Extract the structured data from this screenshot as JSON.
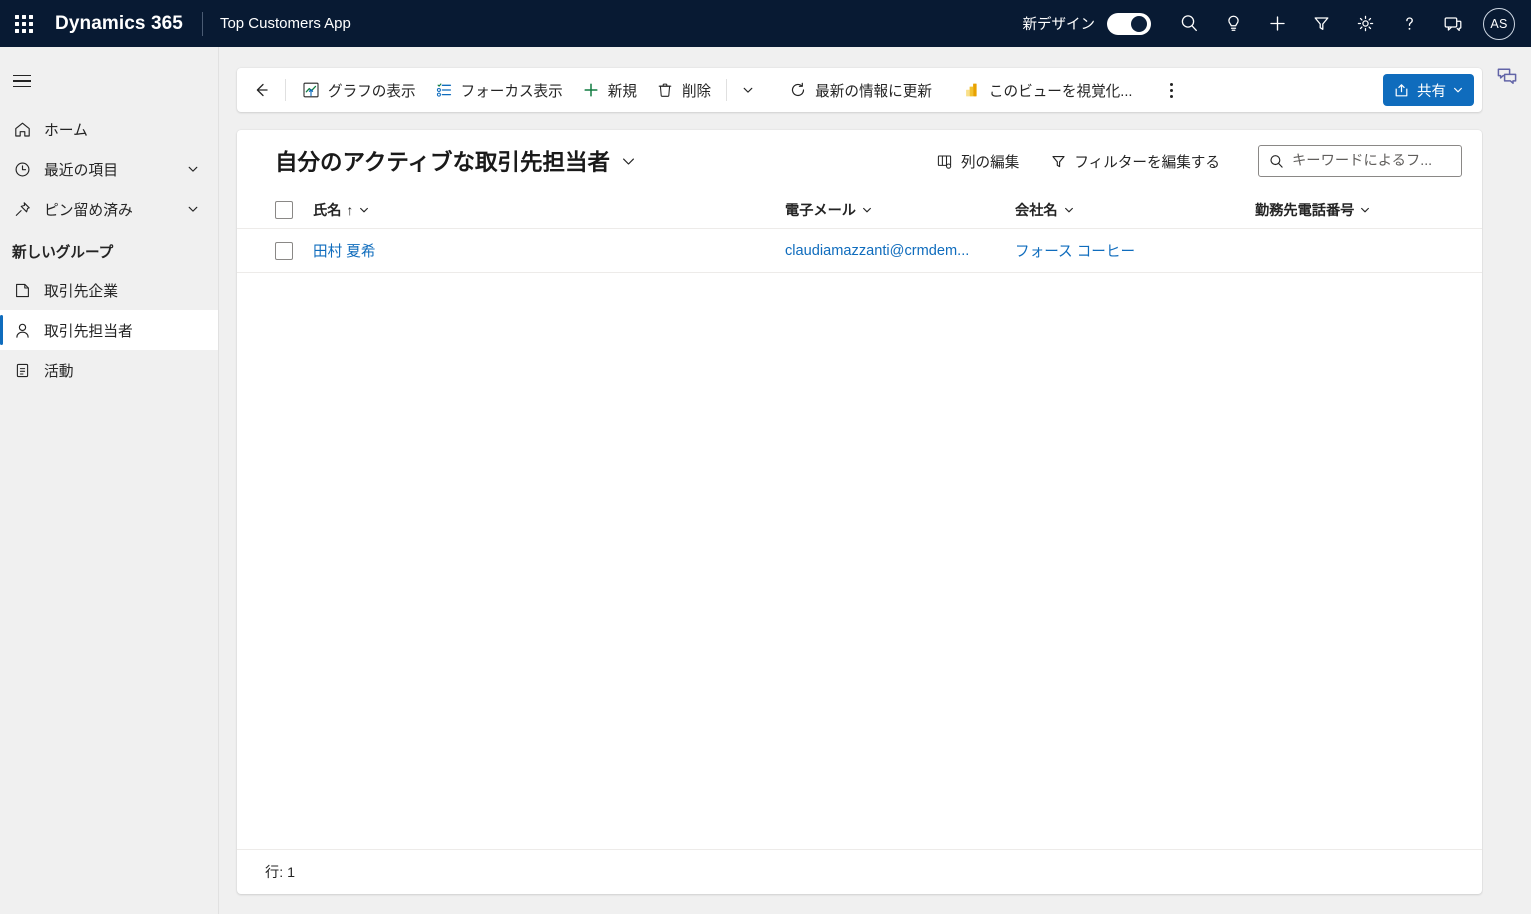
{
  "header": {
    "waffle_icon": "app-launcher-icon",
    "brand": "Dynamics 365",
    "app_name": "Top Customers App",
    "new_design_label": "新デザイン",
    "new_design_toggle_state": "on",
    "icons": [
      {
        "name": "search-icon",
        "label": "検索"
      },
      {
        "name": "lightbulb-icon",
        "label": "アシスト"
      },
      {
        "name": "plus-icon",
        "label": "新規作成"
      },
      {
        "name": "filter-icon",
        "label": "フィルター"
      },
      {
        "name": "gear-icon",
        "label": "設定"
      },
      {
        "name": "help-icon",
        "label": "ヘルプ"
      },
      {
        "name": "feedback-icon",
        "label": "フィードバック"
      }
    ],
    "avatar_initials": "AS"
  },
  "sidebar": {
    "hamburger_icon": "hamburger-icon",
    "items": [
      {
        "label": "ホーム",
        "icon": "home-icon",
        "chevron": false,
        "selected": false
      },
      {
        "label": "最近の項目",
        "icon": "clock-icon",
        "chevron": true,
        "selected": false
      },
      {
        "label": "ピン留め済み",
        "icon": "pin-icon",
        "chevron": true,
        "selected": false
      }
    ],
    "group_title": "新しいグループ",
    "group_items": [
      {
        "label": "取引先企業",
        "icon": "account-icon",
        "selected": false
      },
      {
        "label": "取引先担当者",
        "icon": "contact-person-icon",
        "selected": true
      },
      {
        "label": "活動",
        "icon": "activity-clipboard-icon",
        "selected": false
      }
    ]
  },
  "command_bar": {
    "back_icon": "back-arrow-icon",
    "buttons": [
      {
        "label": "グラフの表示",
        "icon": "show-chart-icon"
      },
      {
        "label": "フォーカス表示",
        "icon": "focused-view-icon"
      },
      {
        "label": "新規",
        "icon": "plus-icon"
      },
      {
        "label": "削除",
        "icon": "trash-icon"
      }
    ],
    "delete_chevron_icon": "chevron-down-icon",
    "refresh": {
      "label": "最新の情報に更新",
      "icon": "refresh-icon"
    },
    "visualize": {
      "label": "このビューを視覚化...",
      "icon": "power-bi-icon"
    },
    "overflow_icon": "more-options-icon",
    "share": {
      "label": "共有",
      "icon": "share-icon",
      "chevron_icon": "chevron-down-icon",
      "color": "#0f6cbd"
    }
  },
  "view": {
    "title": "自分のアクティブな取引先担当者",
    "title_chevron_icon": "chevron-down-icon",
    "edit_columns": {
      "label": "列の編集",
      "icon": "edit-columns-icon"
    },
    "edit_filters": {
      "label": "フィルターを編集する",
      "icon": "filter-icon"
    },
    "search": {
      "placeholder": "キーワードによるフ...",
      "icon": "search-icon",
      "value": ""
    }
  },
  "grid": {
    "select_all_checkbox": "unchecked",
    "columns": [
      {
        "key": "name",
        "label": "氏名",
        "sort": "↑",
        "sorted": true
      },
      {
        "key": "email",
        "label": "電子メール",
        "sort": "",
        "sorted": false
      },
      {
        "key": "company",
        "label": "会社名",
        "sort": "",
        "sorted": false
      },
      {
        "key": "phone",
        "label": "勤務先電話番号",
        "sort": "",
        "sorted": false
      }
    ],
    "rows": [
      {
        "checkbox": "unchecked",
        "name": "田村 夏希",
        "email": "claudiamazzanti@crmdem...",
        "company": "フォース コーヒー",
        "phone": ""
      }
    ],
    "footer_text": "行: 1"
  },
  "right_rail": {
    "chat_icon": "chat-bubbles-icon",
    "chat_icon_color": "#6264a7"
  }
}
